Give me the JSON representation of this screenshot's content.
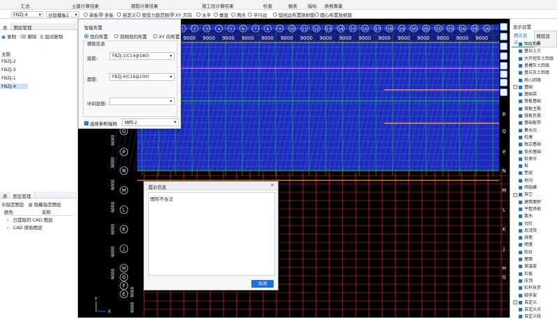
{
  "ribbon": {
    "tabs": [
      "汇总",
      "土建计算结果",
      "钢筋计算结果",
      "施工段计算结果",
      "检查",
      "报表",
      "指标",
      "表格算量"
    ]
  },
  "toolbar": {
    "component_select": "FBZJ-4",
    "layer_select": "分层模板1",
    "radios": [
      "单板",
      "多板",
      "自定义",
      "按受力筋范围",
      "XY 方向",
      "水平",
      "垂直",
      "两点",
      "平行边",
      "弧线边布置放射筋",
      "圆心布置放射筋"
    ],
    "radio_checked": [
      false,
      true,
      false,
      false,
      true,
      false,
      false,
      false,
      false,
      false,
      false
    ]
  },
  "left_panel": {
    "tab_a": "表",
    "tab_b": "图层管理",
    "toolbar_copy": "复制",
    "toolbar_delete": "删除",
    "toolbar_layer_copy": "层间复制",
    "tree": [
      "主筋",
      "FBZJ-2",
      "FBZJ-3",
      "FBZJ-1",
      "FBZJ-4"
    ],
    "selected_index": 4,
    "layer_tab_a": "表",
    "layer_tab_b": "图层管理",
    "layer_show": "示指定图层",
    "layer_hide": "隐藏指定图层",
    "col_color": "颜色",
    "col_name": "名称",
    "layers": [
      "已提取的 CAD 图层",
      "CAD 原始图层"
    ]
  },
  "smart_dialog": {
    "title": "智能布置",
    "options": [
      "双向布置",
      "双网双向布置",
      "XY 向布置"
    ],
    "selected_option": 0,
    "section": "钢筋信息",
    "bottom_label": "底筋:",
    "bottom_value": "FBZJ-1(C14@180)",
    "top_label": "面筋:",
    "top_value": "FBZJ-4(C16@200)",
    "mid_label": "中间层筋:",
    "mid_value": "",
    "axis_check_label": "选择参照轴网",
    "axis_value": "轴网-2"
  },
  "message_dialog": {
    "title": "提示信息",
    "close_x": "✕",
    "message": "图形不合法",
    "close_button": "关闭"
  },
  "canvas": {
    "top_dims": [
      "9000",
      "9000",
      "9000",
      "9000",
      "9000",
      "9000",
      "9000",
      "9000",
      "9000",
      "9000",
      "9000",
      "9000",
      "9000",
      "9000",
      "9000",
      "9000"
    ],
    "axis_numbers_top": [
      "1",
      "2",
      "3",
      "4",
      "5",
      "6",
      "7",
      "8",
      "9",
      "10",
      "11",
      "12",
      "13",
      "14",
      "15",
      "16",
      "17",
      "18",
      "19",
      "20",
      "21",
      "22",
      "23",
      "24",
      "25",
      "26"
    ],
    "row_letters_left": [
      "R",
      "Q",
      "P",
      "N",
      "M",
      "L",
      "K",
      "J",
      "H",
      "G",
      "F",
      "E"
    ],
    "row_letters_right": [
      "R",
      "Q",
      "P",
      "N",
      "M",
      "L",
      "K",
      "J",
      "H",
      "G",
      "F"
    ],
    "left_dims": [
      "9000",
      "9000",
      "9000",
      "9000",
      "9000",
      "9000",
      "9000",
      "9000"
    ],
    "bottom_dims": [
      "9000",
      "9000"
    ],
    "axis_x": "X",
    "axis_y": "Y"
  },
  "right_panel": {
    "header": "显示设置",
    "tab_a": "图元显示",
    "tab_b": "楼层显示",
    "items": [
      {
        "t": "图层构件",
        "g": 0
      },
      {
        "t": "基坑土方",
        "g": 0
      },
      {
        "t": "大开挖灰土回填",
        "g": 0
      },
      {
        "t": "基槽灰土回填",
        "g": 0
      },
      {
        "t": "基坑灰土回填",
        "g": 0
      },
      {
        "t": "房心回填",
        "g": 0
      },
      {
        "t": "基础",
        "g": 1
      },
      {
        "t": "基础梁",
        "g": 0
      },
      {
        "t": "筏板基础",
        "g": 0
      },
      {
        "t": "筏板主筋",
        "g": 0
      },
      {
        "t": "筏板负筋",
        "g": 0
      },
      {
        "t": "基础板带",
        "g": 0
      },
      {
        "t": "集水坑",
        "g": 0
      },
      {
        "t": "柱墩",
        "g": 0
      },
      {
        "t": "独立基础",
        "g": 0
      },
      {
        "t": "条形基础",
        "g": 0
      },
      {
        "t": "桩承台",
        "g": 0
      },
      {
        "t": "桩",
        "g": 0
      },
      {
        "t": "垫层",
        "g": 0
      },
      {
        "t": "地沟",
        "g": 0
      },
      {
        "t": "砖胎膜",
        "g": 0
      },
      {
        "t": "其它",
        "g": 1
      },
      {
        "t": "建筑面积",
        "g": 0
      },
      {
        "t": "平整场地",
        "g": 0
      },
      {
        "t": "散水",
        "g": 0
      },
      {
        "t": "台阶",
        "g": 0
      },
      {
        "t": "后浇带",
        "g": 0
      },
      {
        "t": "挑檐",
        "g": 0
      },
      {
        "t": "雨篷",
        "g": 0
      },
      {
        "t": "阳台",
        "g": 0
      },
      {
        "t": "屋面",
        "g": 0
      },
      {
        "t": "保温层",
        "g": 0
      },
      {
        "t": "栏板",
        "g": 0
      },
      {
        "t": "压顶",
        "g": 0
      },
      {
        "t": "栏杆扶手",
        "g": 0
      },
      {
        "t": "脚手架",
        "g": 0
      },
      {
        "t": "自定义",
        "g": 1
      },
      {
        "t": "自定义点",
        "g": 0
      },
      {
        "t": "自定义线",
        "g": 0
      }
    ]
  },
  "colors": {
    "canvas_bg": "#000000",
    "grid_red": "#ff2b2b",
    "slab_blue": "#2233dd",
    "cad_green": "#22cc44",
    "accent": "#1e6fd9"
  }
}
